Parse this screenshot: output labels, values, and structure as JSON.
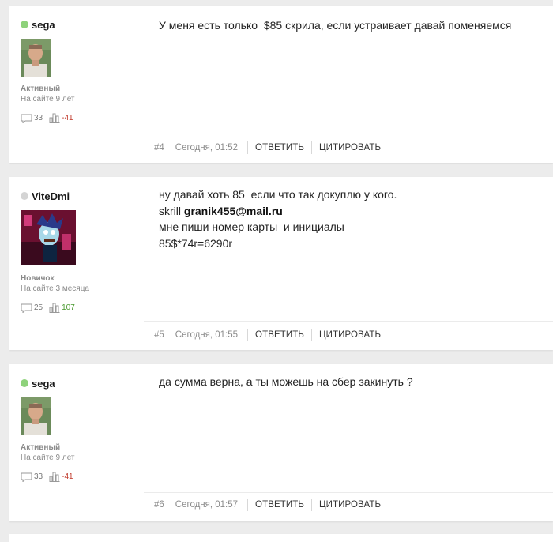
{
  "posts": [
    {
      "author": "sega",
      "online": true,
      "avatar": "photo-avatar",
      "rank": "Активный",
      "since": "На сайте 9 лет",
      "comments": "33",
      "reputation": "-41",
      "content": [
        "У меня есть только  $85 скрила, если устраивает давай поменяемся"
      ],
      "number": "#4",
      "date": "Сегодня, 01:52"
    },
    {
      "author": "ViteDmi",
      "online": false,
      "avatar": "cartoon-avatar",
      "rank": "Новичок",
      "since": "На сайте 3 месяца",
      "comments": "25",
      "reputation": "107",
      "content_line1": "ну давай хоть 85  если что так докуплю у кого.",
      "skrill_prefix": "skrill ",
      "email": "granik455@mail.ru",
      "content_line3": "мне пиши номер карты  и инициалы",
      "content_line4": "85$*74r=6290r",
      "number": "#5",
      "date": "Сегодня, 01:55"
    },
    {
      "author": "sega",
      "online": true,
      "avatar": "photo-avatar",
      "rank": "Активный",
      "since": "На сайте 9 лет",
      "comments": "33",
      "reputation": "-41",
      "content": [
        "да сумма верна, а ты можешь на сбер закинуть ?"
      ],
      "number": "#6",
      "date": "Сегодня, 01:57"
    }
  ],
  "actions": {
    "reply": "ОТВЕТИТЬ",
    "quote": "ЦИТИРОВАТЬ"
  },
  "colors": {
    "online": "#8ed27b",
    "offline": "#d4d4d4",
    "rep_negative": "#c0392b",
    "rep_positive": "#4a9a2f"
  }
}
